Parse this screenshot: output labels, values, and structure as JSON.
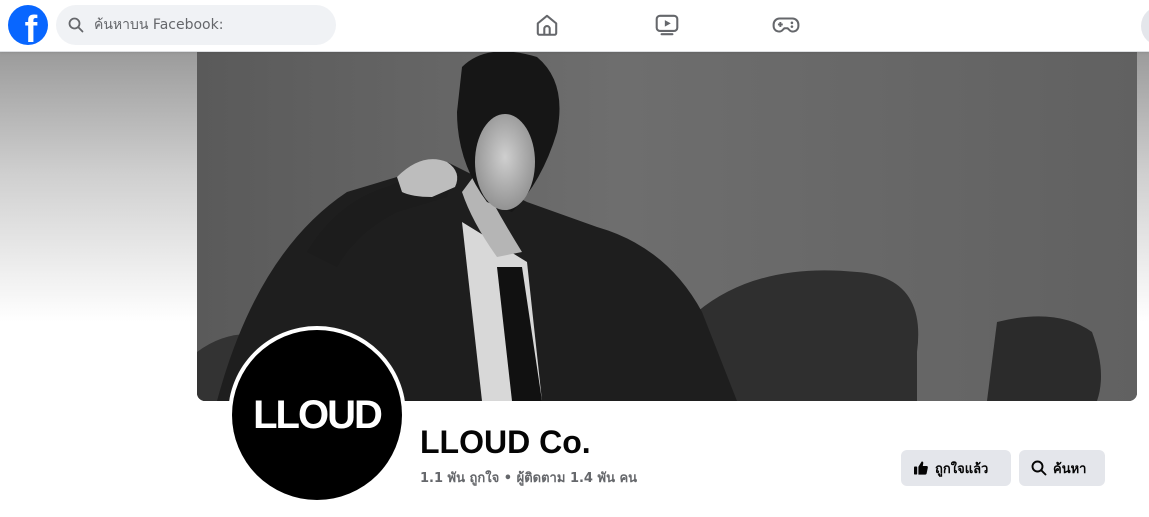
{
  "topbar": {
    "logo_letter": "f",
    "search_placeholder": "ค้นหาบน Facebook:",
    "nav": [
      "home-icon",
      "watch-icon",
      "gaming-icon"
    ]
  },
  "page": {
    "name": "LLOUD Co.",
    "stats": "1.1 พัน ถูกใจ • ผู้ติดตาม 1.4 พัน คน",
    "avatar_text": "LLOUD"
  },
  "actions": {
    "liked_label": "ถูกใจแล้ว",
    "search_label": "ค้นหา"
  },
  "colors": {
    "brand": "#0866ff",
    "button_bg": "#e4e6eb",
    "secondary_text": "#65676b"
  }
}
